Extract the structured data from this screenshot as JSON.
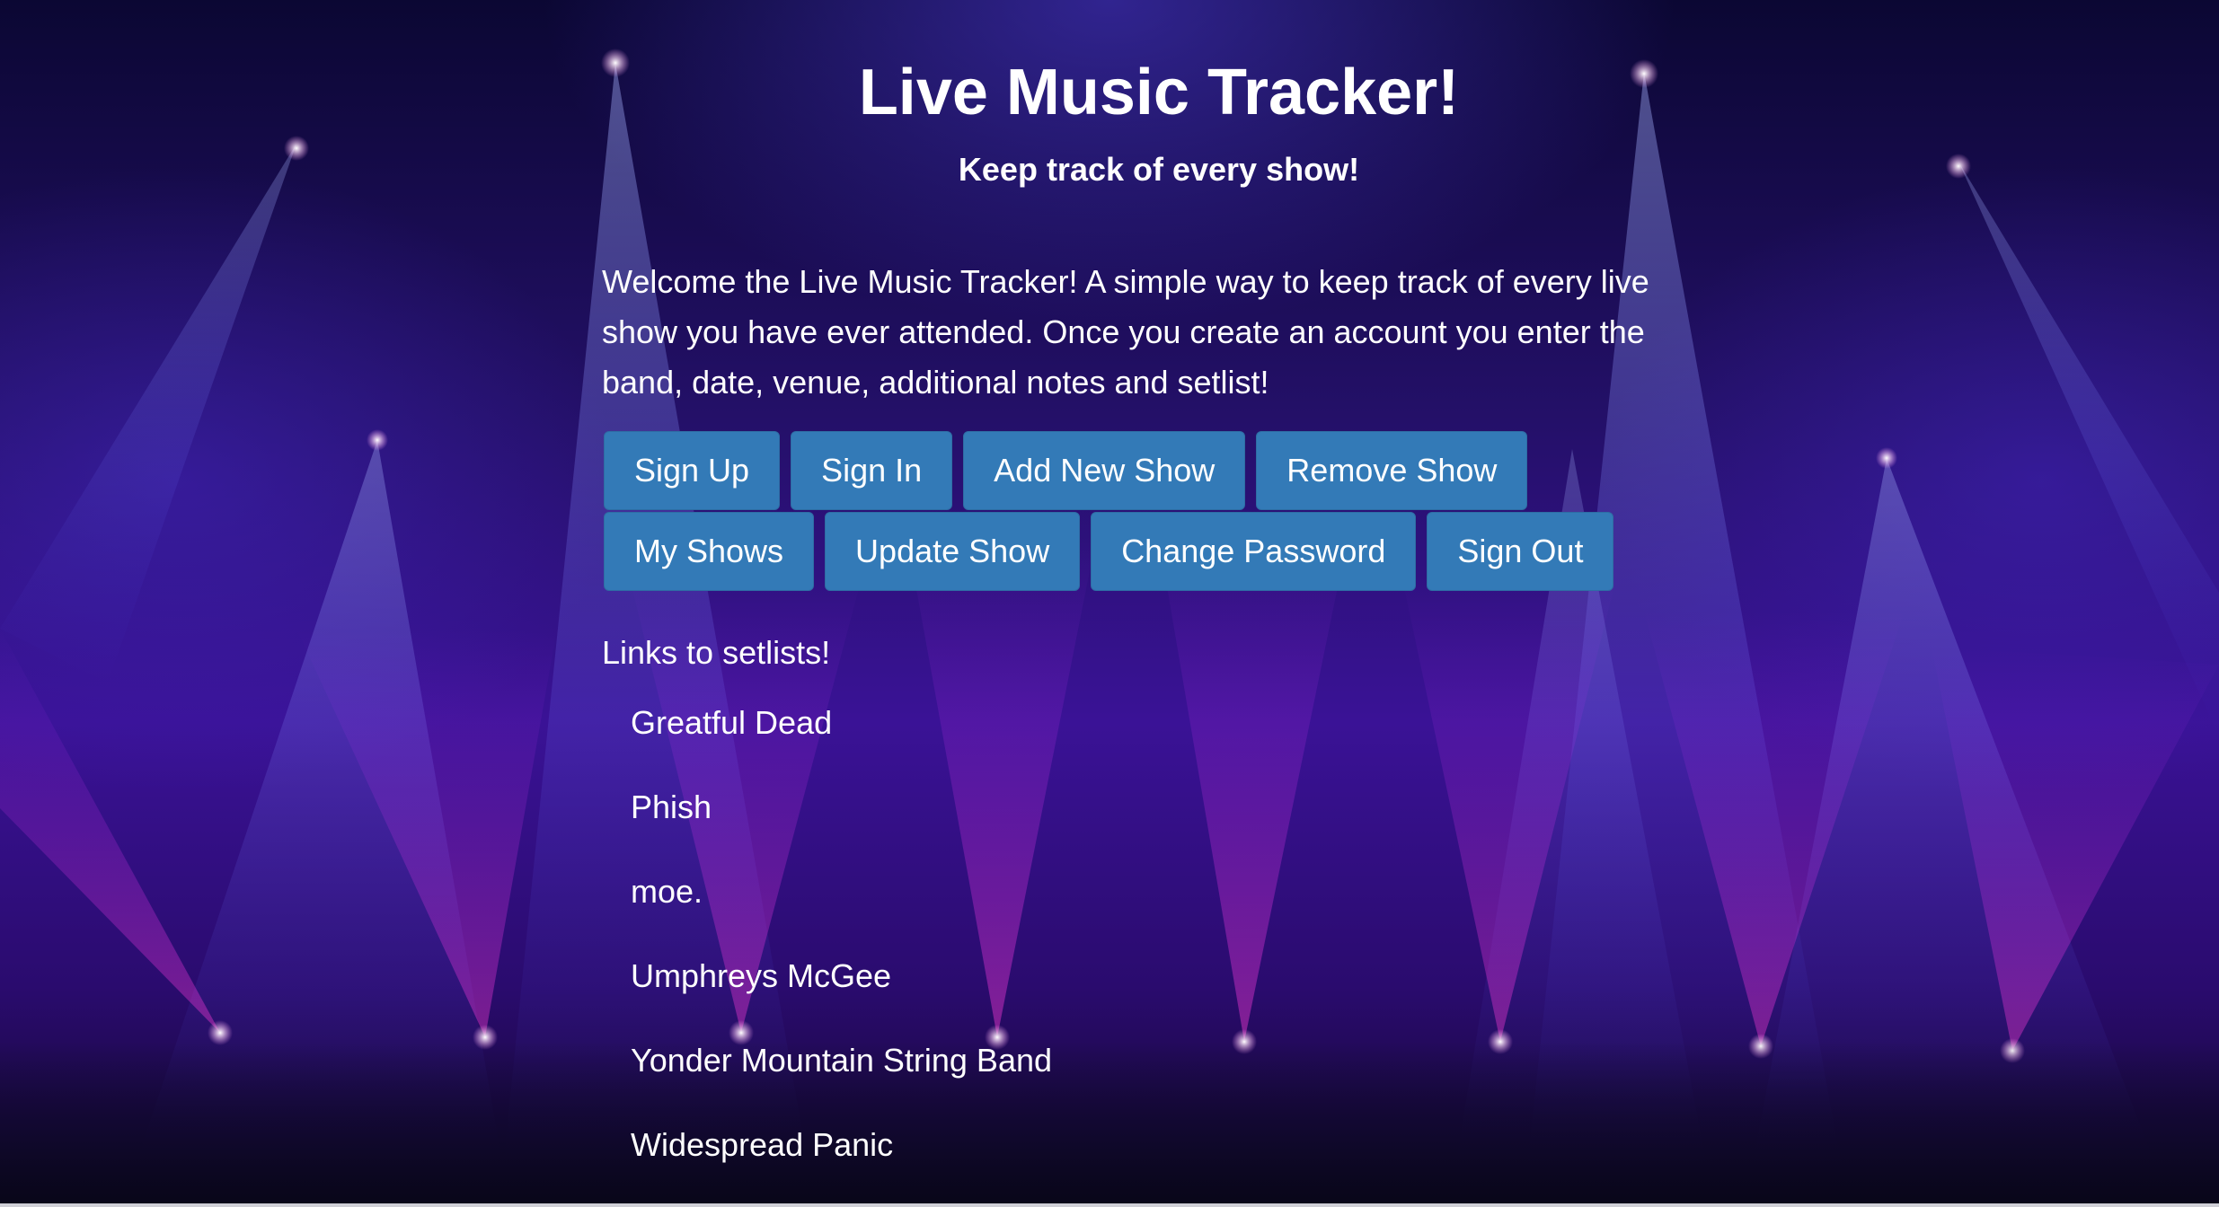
{
  "header": {
    "title": "Live Music Tracker!",
    "subtitle": "Keep track of every show!"
  },
  "intro": {
    "text": "Welcome the Live Music Tracker! A simple way to keep track of every live show you have ever attended. Once you create an account you enter the band, date, venue, additional notes and setlist!"
  },
  "buttons": {
    "sign_up": "Sign Up",
    "sign_in": "Sign In",
    "add_new_show": "Add New Show",
    "remove_show": "Remove Show",
    "my_shows": "My Shows",
    "update_show": "Update Show",
    "change_password": "Change Password",
    "sign_out": "Sign Out"
  },
  "setlists": {
    "heading": "Links to setlists!",
    "links": [
      "Greatful Dead",
      "Phish",
      "moe.",
      "Umphreys McGee",
      "Yonder Mountain String Band",
      "Widespread Panic"
    ]
  },
  "colors": {
    "button_bg": "#337ab7",
    "text": "#ffffff",
    "background_purple": "#3a1296",
    "spotlight_pink": "#ff2fd0",
    "spotlight_blue": "#6a7dff"
  }
}
